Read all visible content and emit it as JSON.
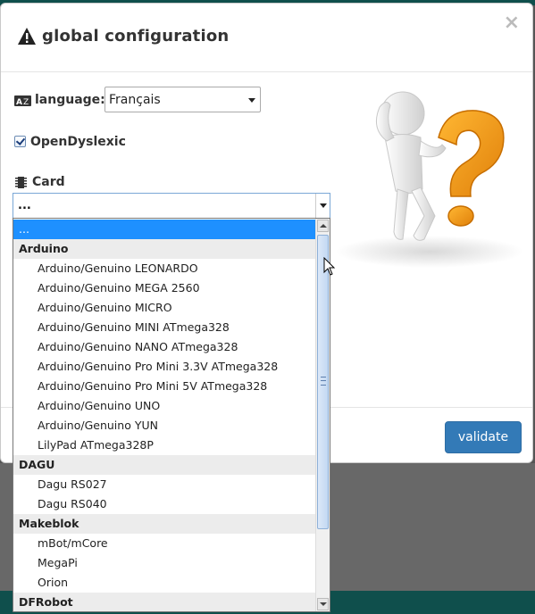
{
  "dialog": {
    "title": "global configuration",
    "close_label": "×",
    "validate_label": "validate"
  },
  "language": {
    "label": "language:",
    "selected": "Français"
  },
  "dyslexic": {
    "label": "OpenDyslexic",
    "checked": true
  },
  "card": {
    "label": "Card",
    "selected": "..."
  },
  "dropdown": {
    "options": [
      {
        "kind": "selected",
        "label": "..."
      },
      {
        "kind": "group",
        "label": "Arduino"
      },
      {
        "kind": "item",
        "label": "Arduino/Genuino LEONARDO"
      },
      {
        "kind": "item",
        "label": "Arduino/Genuino MEGA 2560"
      },
      {
        "kind": "item",
        "label": "Arduino/Genuino MICRO"
      },
      {
        "kind": "item",
        "label": "Arduino/Genuino MINI ATmega328"
      },
      {
        "kind": "item",
        "label": "Arduino/Genuino NANO ATmega328"
      },
      {
        "kind": "item",
        "label": "Arduino/Genuino Pro Mini 3.3V ATmega328"
      },
      {
        "kind": "item",
        "label": "Arduino/Genuino Pro Mini 5V ATmega328"
      },
      {
        "kind": "item",
        "label": "Arduino/Genuino UNO"
      },
      {
        "kind": "item",
        "label": "Arduino/Genuino YUN"
      },
      {
        "kind": "item",
        "label": "LilyPad ATmega328P"
      },
      {
        "kind": "group",
        "label": "DAGU"
      },
      {
        "kind": "item",
        "label": "Dagu RS027"
      },
      {
        "kind": "item",
        "label": "Dagu RS040"
      },
      {
        "kind": "group",
        "label": "Makeblok"
      },
      {
        "kind": "item",
        "label": "mBot/mCore"
      },
      {
        "kind": "item",
        "label": "MegaPi"
      },
      {
        "kind": "item",
        "label": "Orion"
      },
      {
        "kind": "group",
        "label": "DFRobot"
      }
    ]
  },
  "colors": {
    "accent": "#337ab7",
    "selection": "#1e90ff",
    "question_mark": "#f39c12"
  },
  "icons": {
    "title": "warning-icon",
    "language": "language-icon",
    "card": "chip-icon",
    "illustration": "thinking-person-question-mark"
  }
}
